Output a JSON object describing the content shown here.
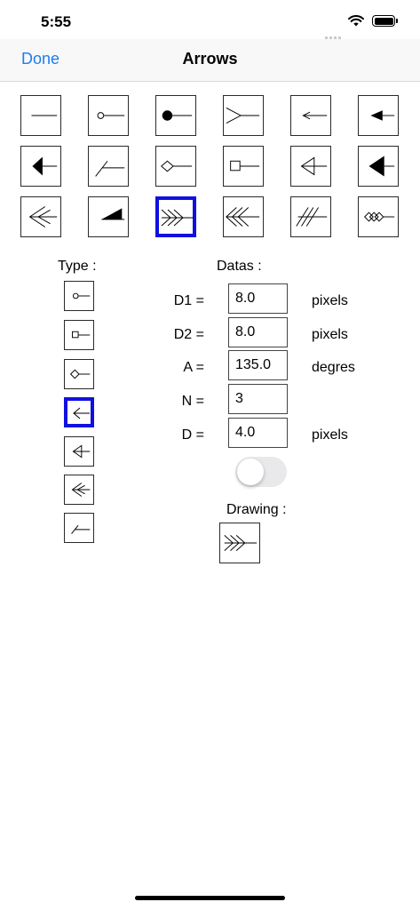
{
  "status_bar": {
    "time": "5:55"
  },
  "navbar": {
    "done_label": "Done",
    "title": "Arrows"
  },
  "arrow_styles": [
    {
      "icon": "line-plain-icon"
    },
    {
      "icon": "arrow-open-circle-icon"
    },
    {
      "icon": "arrow-filled-circle-icon"
    },
    {
      "icon": "arrow-open-v-icon"
    },
    {
      "icon": "arrow-small-open-icon"
    },
    {
      "icon": "arrow-filled-triangle-icon"
    },
    {
      "icon": "arrow-large-filled-triangle-icon"
    },
    {
      "icon": "arrow-slash-icon"
    },
    {
      "icon": "arrow-open-diamond-icon"
    },
    {
      "icon": "arrow-open-square-icon"
    },
    {
      "icon": "arrow-open-triangle-icon"
    },
    {
      "icon": "arrow-filled-triangle-large-icon"
    },
    {
      "icon": "arrow-double-chevron-icon"
    },
    {
      "icon": "arrow-half-filled-icon"
    },
    {
      "icon": "arrow-triple-chevron-icon",
      "selected": true
    },
    {
      "icon": "arrow-triple-chevron-left-icon"
    },
    {
      "icon": "arrow-triple-slash-icon"
    },
    {
      "icon": "arrow-triple-diamond-icon"
    }
  ],
  "type_section": {
    "label": "Type :",
    "types": [
      {
        "icon": "type-circle-icon"
      },
      {
        "icon": "type-square-icon"
      },
      {
        "icon": "type-diamond-icon"
      },
      {
        "icon": "type-arrow-icon",
        "selected": true
      },
      {
        "icon": "type-triangle-icon"
      },
      {
        "icon": "type-double-arrow-icon"
      },
      {
        "icon": "type-slash-icon"
      }
    ]
  },
  "datas_section": {
    "label": "Datas :",
    "fields": [
      {
        "label": "D1 =",
        "value": "8.0",
        "unit": "pixels"
      },
      {
        "label": "D2 =",
        "value": "8.0",
        "unit": "pixels"
      },
      {
        "label": "A =",
        "value": "135.0",
        "unit": "degres"
      },
      {
        "label": "N =",
        "value": "3",
        "unit": ""
      },
      {
        "label": "D =",
        "value": "4.0",
        "unit": "pixels"
      }
    ],
    "toggle_on": false
  },
  "drawing": {
    "label": "Drawing :",
    "icon": "drawing-preview-icon"
  },
  "colors": {
    "accent": "#1a7ef0",
    "selection": "#1010e0"
  }
}
